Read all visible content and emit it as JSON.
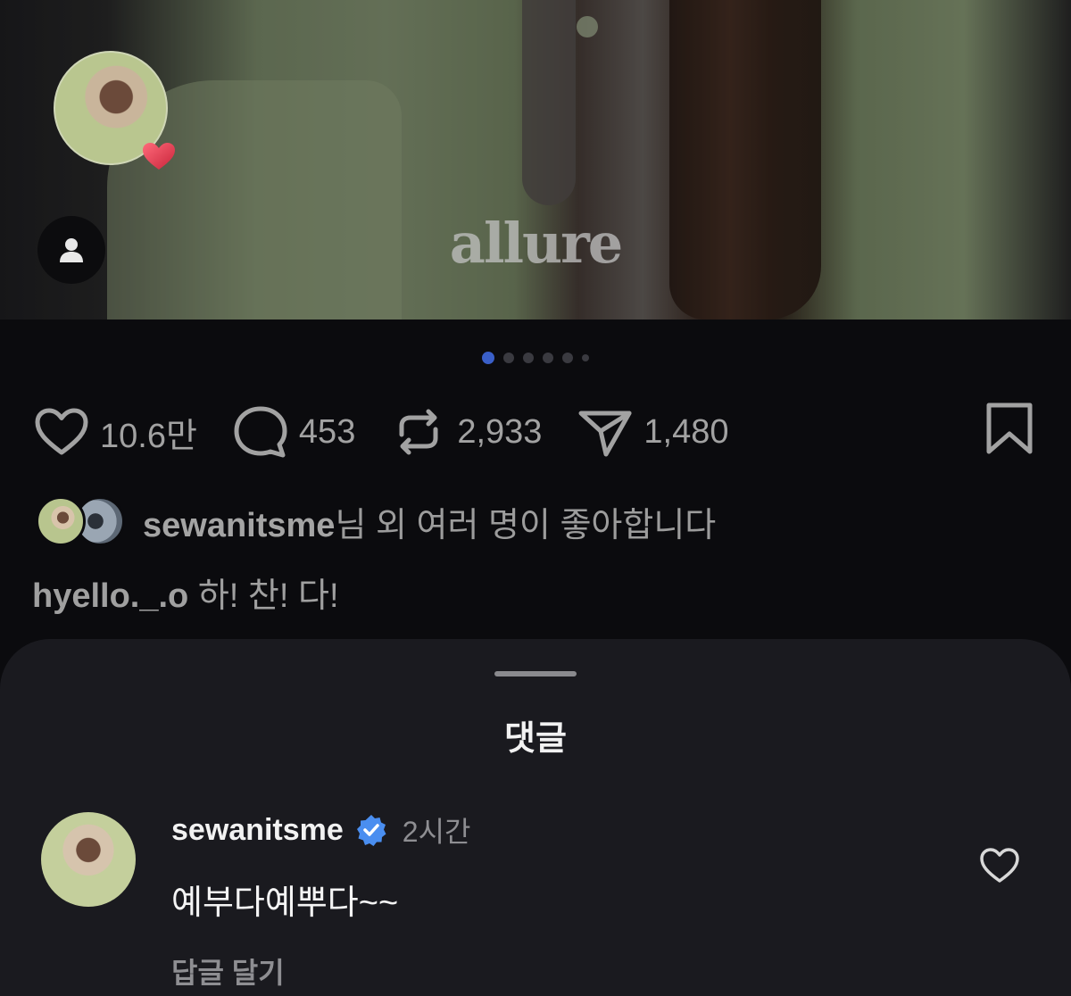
{
  "post": {
    "watermark": "allure",
    "story_avatar_icon": "profile-photo",
    "heart_badge_icon": "heart-icon",
    "profile_button_icon": "person-icon",
    "pagination": {
      "total": 6,
      "active": 1
    }
  },
  "actions": {
    "like_count": "10.6만",
    "comment_count": "453",
    "repost_count": "2,933",
    "share_count": "1,480"
  },
  "likes": {
    "username": "sewanitsme",
    "suffix": "님 외 여러 명이 좋아합니다"
  },
  "caption": {
    "username": "hyello._.o",
    "text": " 하! 찬! 다!"
  },
  "comments_sheet": {
    "title": "댓글",
    "comments": [
      {
        "username": "sewanitsme",
        "time": "2시간",
        "text": "예부다예뿌다~~",
        "reply_label": "답글 달기"
      }
    ]
  },
  "colors": {
    "background": "#0b0b0e",
    "sheet": "#1a1a1f",
    "accent_blue": "#3a5fc8",
    "verified_blue": "#4a8ef0",
    "heart_red": "#e0414f"
  }
}
